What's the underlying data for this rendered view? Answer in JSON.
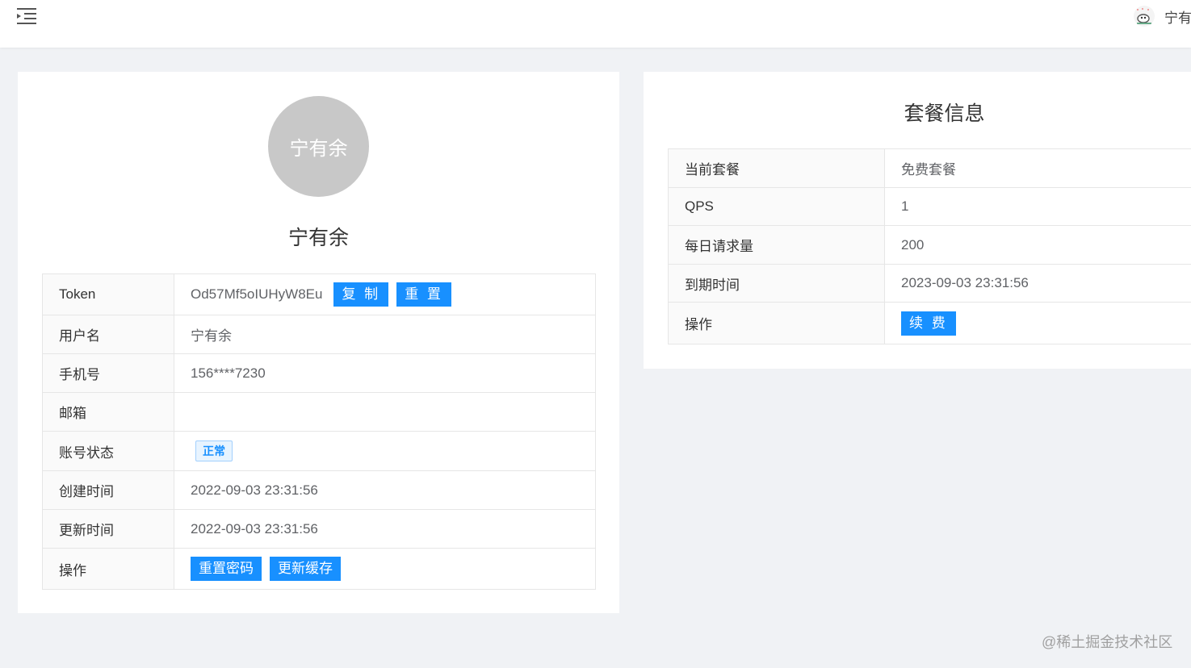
{
  "header": {
    "menu_icon": "menu-fold-icon",
    "user_avatar_icon": "user-avatar-icon",
    "username": "宁有余"
  },
  "profile": {
    "avatar_text": "宁有余",
    "name": "宁有余",
    "rows": [
      {
        "label": "Token",
        "value": "Od57Mf5oIUHyW8Eu",
        "copy_button": "复 制",
        "reset_button": "重 置"
      },
      {
        "label": "用户名",
        "value": "宁有余"
      },
      {
        "label": "手机号",
        "value": "156****7230"
      },
      {
        "label": "邮箱",
        "value": ""
      },
      {
        "label": "账号状态",
        "value": "正常"
      },
      {
        "label": "创建时间",
        "value": "2022-09-03 23:31:56"
      },
      {
        "label": "更新时间",
        "value": "2022-09-03 23:31:56"
      },
      {
        "label": "操作",
        "reset_password_button": "重置密码",
        "refresh_cache_button": "更新缓存"
      }
    ]
  },
  "plan": {
    "title": "套餐信息",
    "rows": [
      {
        "label": "当前套餐",
        "value": "免费套餐"
      },
      {
        "label": "QPS",
        "value": "1"
      },
      {
        "label": "每日请求量",
        "value": "200"
      },
      {
        "label": "到期时间",
        "value": "2023-09-03 23:31:56"
      },
      {
        "label": "操作",
        "renew_button": "续 费"
      }
    ]
  },
  "colors": {
    "primary": "#1890ff",
    "page_bg": "#f0f2f5",
    "avatar_bg": "#c8c8c8"
  },
  "watermark": "@稀土掘金技术社区"
}
